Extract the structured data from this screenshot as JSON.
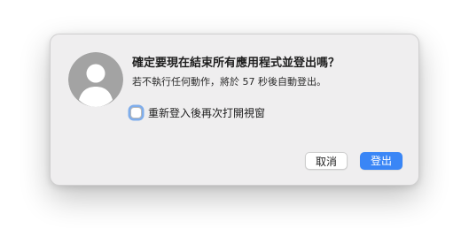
{
  "dialog": {
    "avatar_icon": "user-silhouette-icon",
    "title": "確定要現在結束所有應用程式並登出嗎？",
    "message": "若不執行任何動作，將於 57 秒後自動登出。",
    "checkbox": {
      "label": "重新登入後再次打開視窗",
      "checked": false
    },
    "buttons": {
      "cancel_label": "取消",
      "logout_label": "登出"
    },
    "colors": {
      "accent": "#3a86f6",
      "dialog_background": "#efeeef",
      "avatar_background": "#a3a3a3"
    }
  }
}
